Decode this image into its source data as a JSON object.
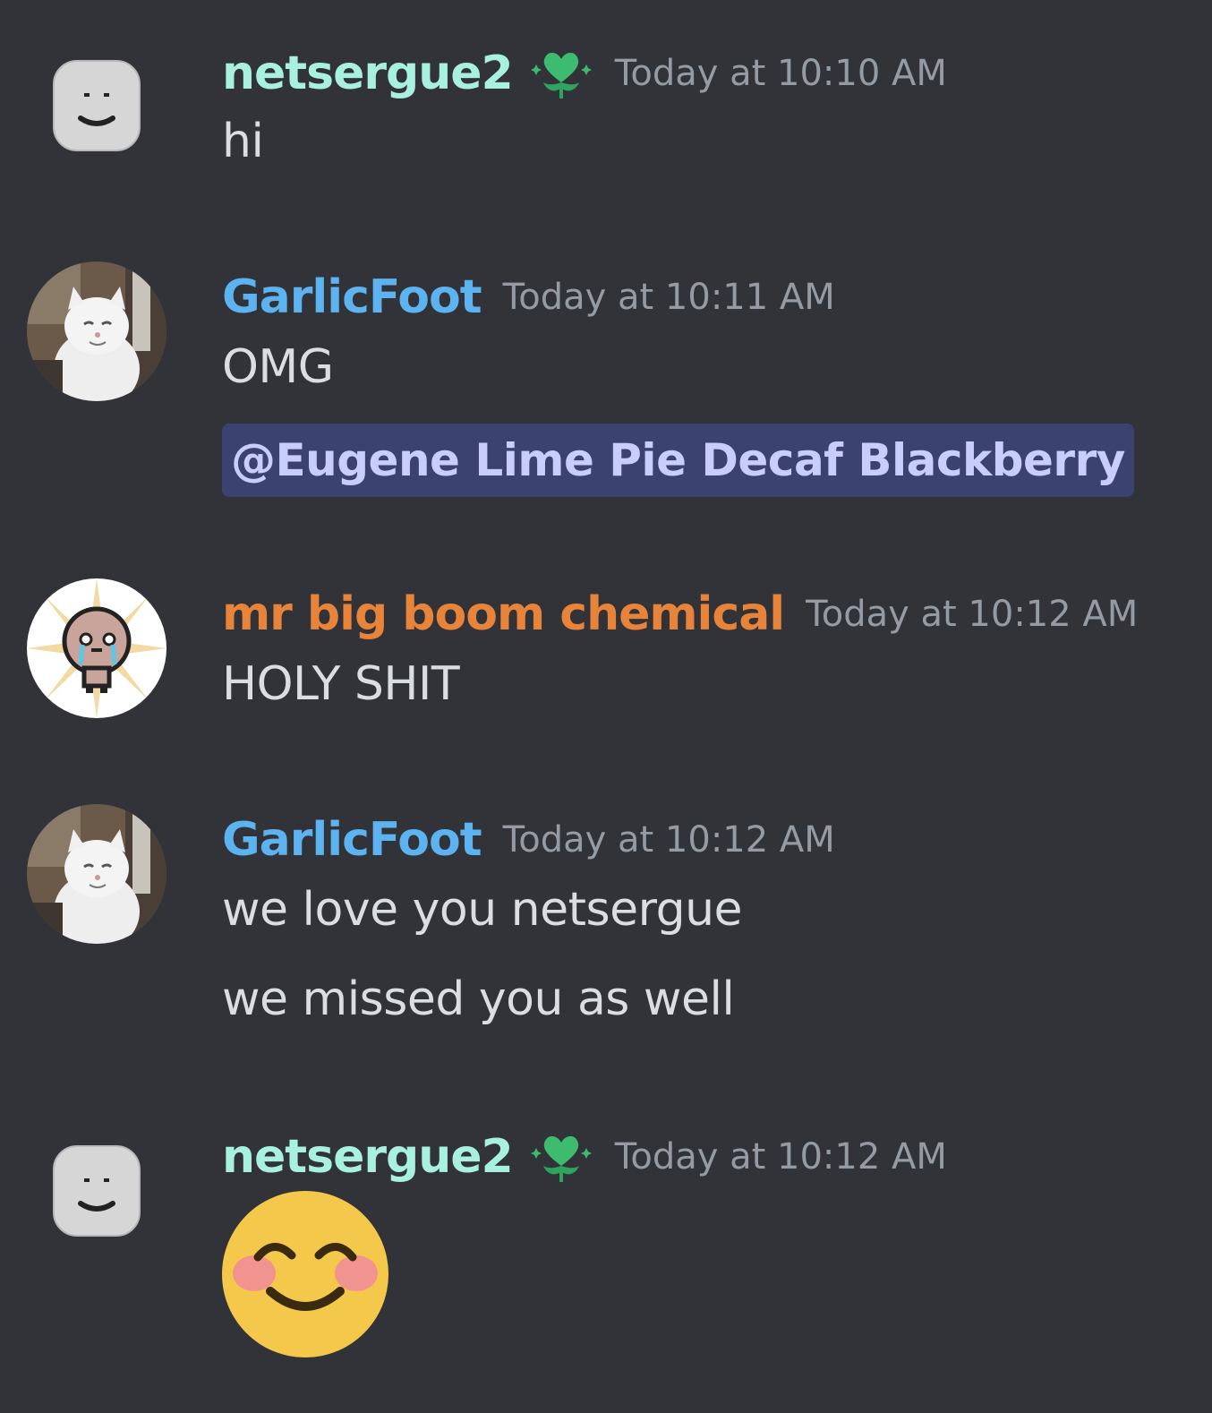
{
  "colors": {
    "background": "#313338",
    "netsergue_name": "#a8f0e0",
    "garlicfoot_name": "#5cb3f0",
    "chemical_name": "#e8843a",
    "timestamp": "#949ba4",
    "message_text": "#dbdee1",
    "mention_bg": "#3c4270",
    "mention_text": "#c9cdfb"
  },
  "messages": [
    {
      "author": "netsergue2",
      "role_icon": "heart-flower-icon",
      "timestamp": "Today at 10:10 AM",
      "lines": [
        "hi"
      ]
    },
    {
      "author": "GarlicFoot",
      "timestamp": "Today at 10:11 AM",
      "lines": [
        "OMG"
      ],
      "mention": "@Eugene Lime Pie Decaf Blackberry"
    },
    {
      "author": "mr big boom chemical",
      "timestamp": "Today at 10:12 AM",
      "lines": [
        "HOLY SHIT"
      ]
    },
    {
      "author": "GarlicFoot",
      "timestamp": "Today at 10:12 AM",
      "lines": [
        "we love you netsergue",
        "we missed you as well"
      ]
    },
    {
      "author": "netsergue2",
      "role_icon": "heart-flower-icon",
      "timestamp": "Today at 10:12 AM",
      "emoji": "smiling-face-with-smiling-eyes-emoji"
    }
  ]
}
